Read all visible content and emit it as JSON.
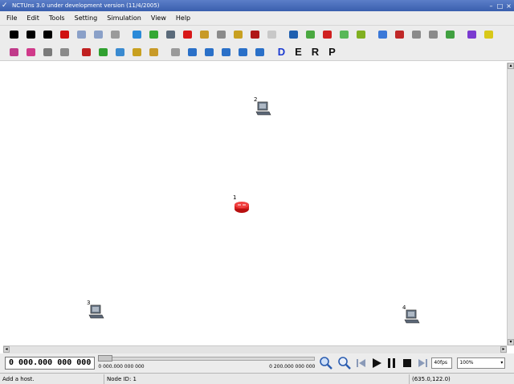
{
  "window": {
    "title": "NCTUns 3.0 under development version (11/4/2005)"
  },
  "menubar": {
    "items": [
      "File",
      "Edit",
      "Tools",
      "Setting",
      "Simulation",
      "View",
      "Help"
    ]
  },
  "toolbar1": {
    "icons": [
      {
        "name": "pointer-icon",
        "color": "#000000"
      },
      {
        "name": "delete-icon",
        "color": "#000000"
      },
      {
        "name": "text-icon",
        "color": "#000000"
      },
      {
        "name": "link-icon",
        "color": "#d01010"
      },
      {
        "name": "undo-icon",
        "color": "#8aa0c8"
      },
      {
        "name": "redo-icon",
        "color": "#8aa0c8"
      },
      {
        "name": "wireless-icon",
        "color": "#9a9a9a"
      },
      {
        "name": "hub-icon",
        "color": "#2a8ad8"
      },
      {
        "name": "switch-icon",
        "color": "#34a834"
      },
      {
        "name": "host-icon",
        "color": "#5a6a7a"
      },
      {
        "name": "router-icon",
        "color": "#d81818"
      },
      {
        "name": "access-point-icon",
        "color": "#c89a28"
      },
      {
        "name": "mobile-node-icon",
        "color": "#8a8a8a"
      },
      {
        "name": "obstacle-icon",
        "color": "#c8a020"
      },
      {
        "name": "wall-icon",
        "color": "#b01818"
      },
      {
        "name": "disabled-icon",
        "color": "#c8c8c8"
      },
      {
        "name": "move-icon",
        "color": "#2060b0"
      },
      {
        "name": "gprs-icon",
        "color": "#4aa840"
      },
      {
        "name": "gprs-sgsn-icon",
        "color": "#d02020"
      },
      {
        "name": "gprs-ggsn-icon",
        "color": "#58b858"
      },
      {
        "name": "satellite-icon",
        "color": "#80b020"
      },
      {
        "name": "optical-icon",
        "color": "#3a78d8"
      },
      {
        "name": "ethernet-icon",
        "color": "#c02828"
      },
      {
        "name": "fiber-icon",
        "color": "#8a8a8a"
      },
      {
        "name": "antenna-icon",
        "color": "#8a8a8a"
      },
      {
        "name": "pole-icon",
        "color": "#40a040"
      },
      {
        "name": "qos-node-icon",
        "color": "#7a3ad0"
      },
      {
        "name": "qos-router-icon",
        "color": "#d8c818"
      }
    ]
  },
  "toolbar2": {
    "icons": [
      {
        "name": "group-a-icon",
        "color": "#c03a8a"
      },
      {
        "name": "group-b-icon",
        "color": "#d03a8a"
      },
      {
        "name": "group-c-icon",
        "color": "#7a7a7a"
      },
      {
        "name": "group-d-icon",
        "color": "#8a8a8a"
      },
      {
        "name": "router-small-icon",
        "color": "#c02020"
      },
      {
        "name": "switch-small-icon",
        "color": "#30a030"
      },
      {
        "name": "hub-small-icon",
        "color": "#3a8ad0"
      },
      {
        "name": "path-icon",
        "color": "#c8a020"
      },
      {
        "name": "ap-small-icon",
        "color": "#c89a28"
      },
      {
        "name": "ruler-icon",
        "color": "#9a9a9a"
      },
      {
        "name": "zoom-icon",
        "color": "#2a70c8"
      },
      {
        "name": "zoom-in-icon",
        "color": "#2a70c8"
      },
      {
        "name": "zoom-out-icon",
        "color": "#2a70c8"
      },
      {
        "name": "zoom-fit-icon",
        "color": "#2a70c8"
      },
      {
        "name": "zoom-reset-icon",
        "color": "#2a70c8"
      }
    ],
    "modes": [
      {
        "label": "D",
        "color": "#1a3ad0"
      },
      {
        "label": "E",
        "color": "#111111"
      },
      {
        "label": "R",
        "color": "#111111"
      },
      {
        "label": "P",
        "color": "#111111"
      }
    ]
  },
  "canvas": {
    "nodes": [
      {
        "id": "2",
        "type": "host"
      },
      {
        "id": "1",
        "type": "router"
      },
      {
        "id": "3",
        "type": "host"
      },
      {
        "id": "4",
        "type": "host"
      }
    ]
  },
  "controlbar": {
    "time_counter": "0 000.000 000 000",
    "time_start": "0 000.000 000 000",
    "time_end": "0 200.000 000 000",
    "fps": "40fps",
    "zoom": "100%",
    "progress": 0
  },
  "statusbar": {
    "message": "Add a host.",
    "node_id": "Node ID: 1",
    "coords": "(635.0,122.0)"
  }
}
